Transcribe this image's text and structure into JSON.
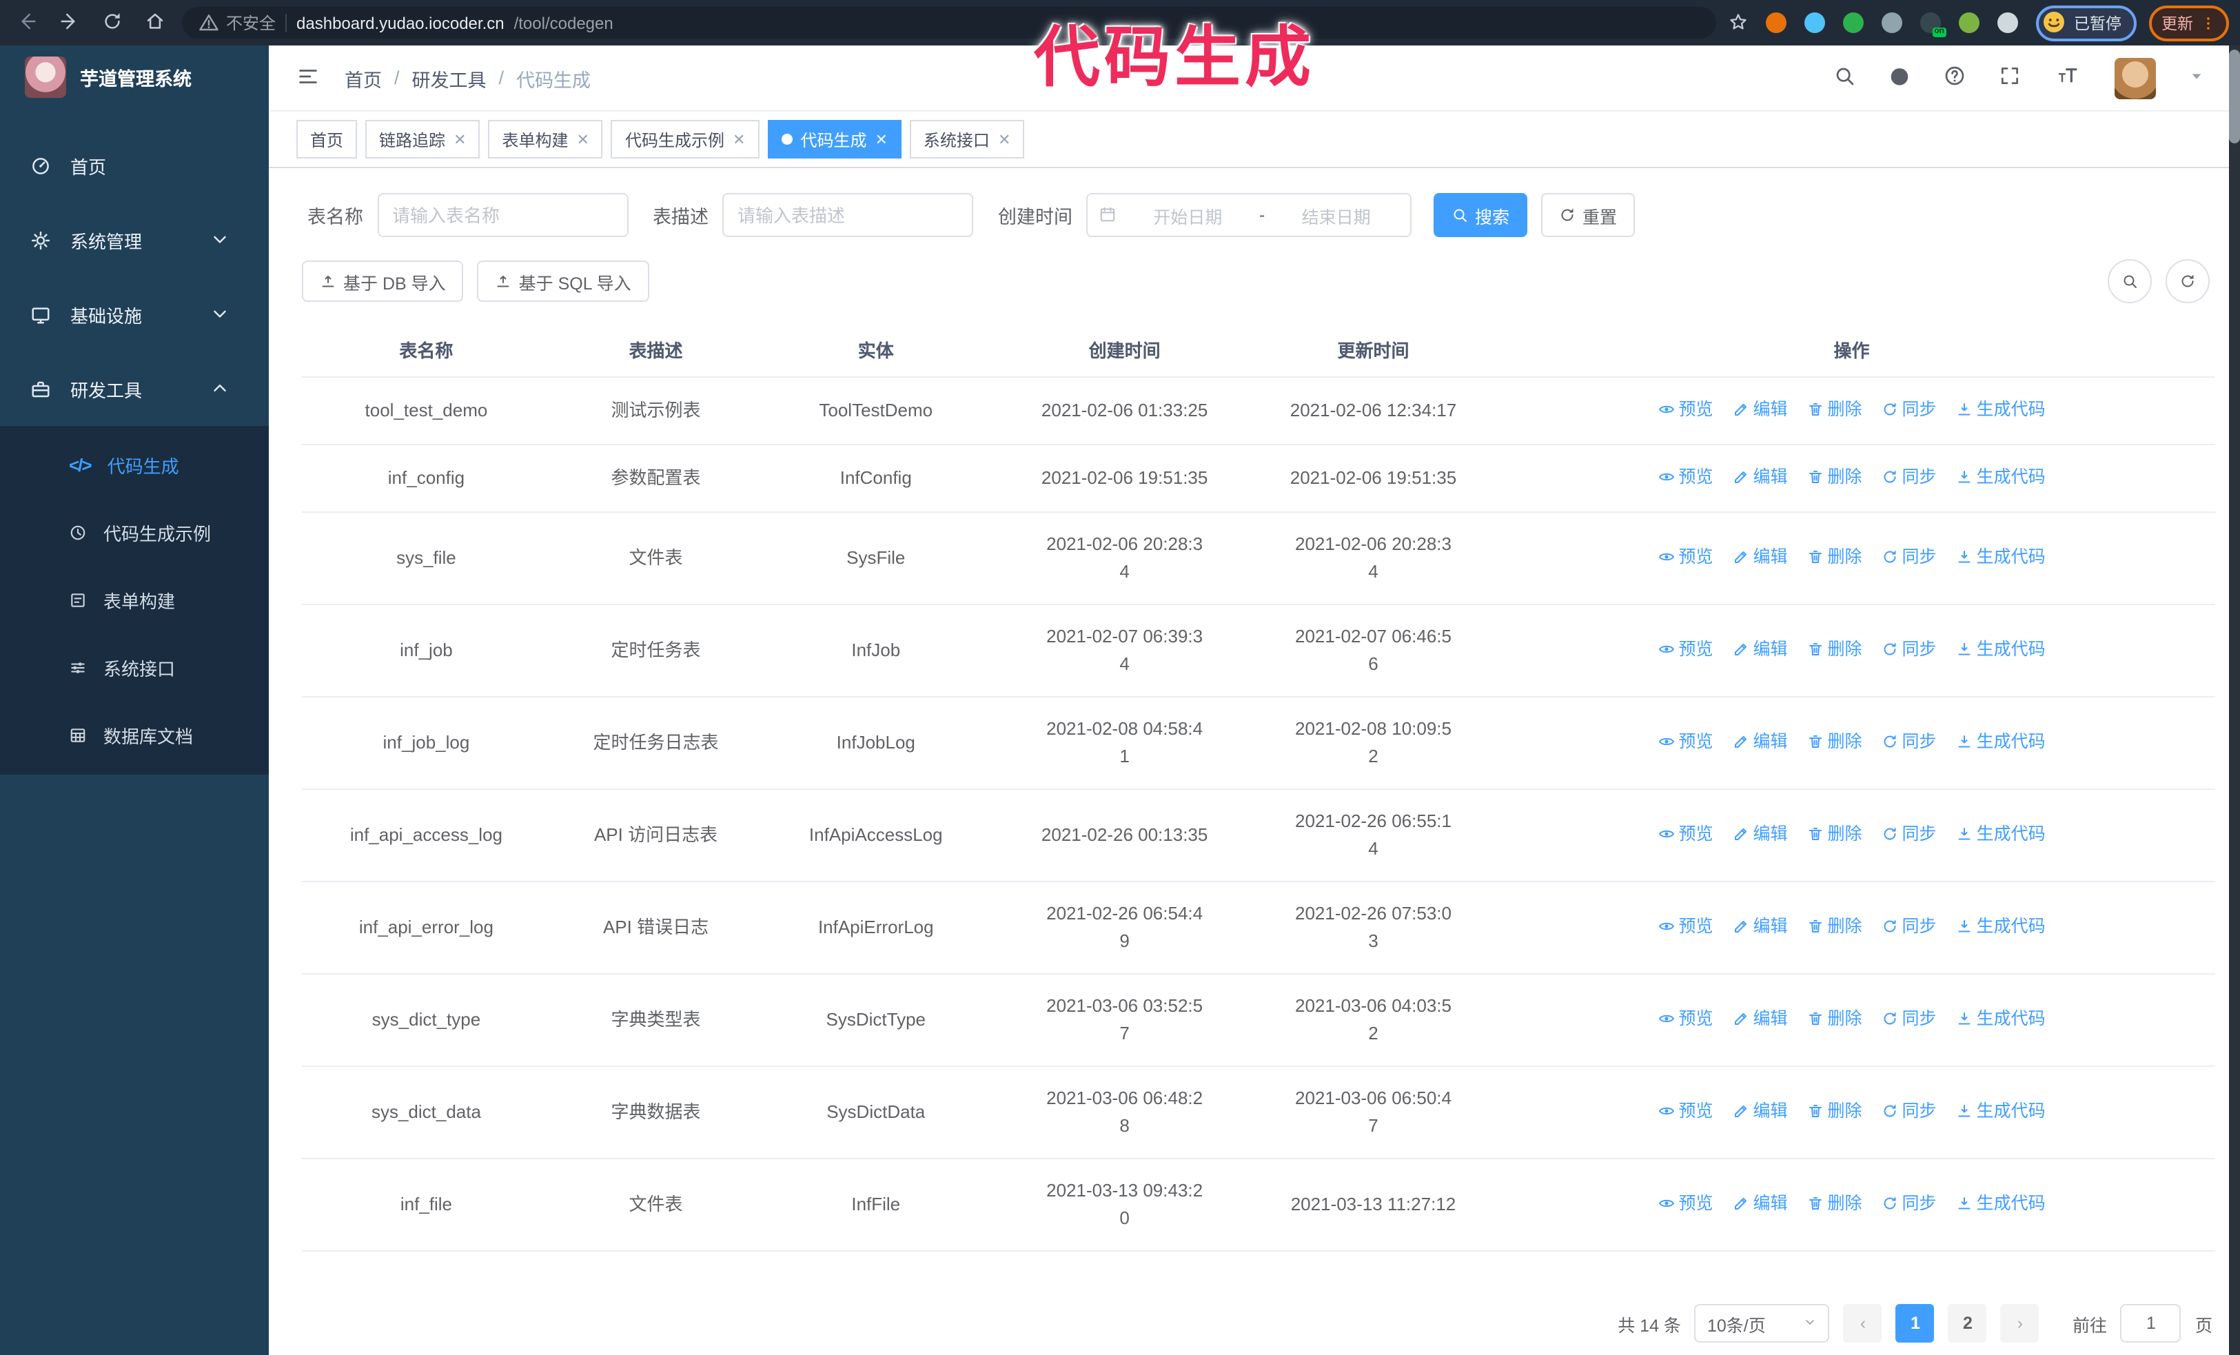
{
  "colors": {
    "accent": "#409eff",
    "annotation": "#ee2c5c",
    "sidebar_bg": "#204058",
    "submenu_bg": "#1a2c40"
  },
  "annotation": {
    "text": "代码生成"
  },
  "browser": {
    "security_label": "不安全",
    "url_host": "dashboard.yudao.iocoder.cn",
    "url_path": "/tool/codegen",
    "profile_chip_label": "已暂停",
    "update_label": "更新",
    "extensions": [
      {
        "name": "ext-orange",
        "color": "#e8710a"
      },
      {
        "name": "ext-blue-drop",
        "color": "#4fc3f7"
      },
      {
        "name": "ext-green-check",
        "color": "#2bb24c"
      },
      {
        "name": "ext-grid",
        "color": "#90a4ae"
      },
      {
        "name": "ext-dark-on",
        "color": "#37474f",
        "badge": "on"
      },
      {
        "name": "ext-green",
        "color": "#7cb342"
      },
      {
        "name": "ext-puzzle",
        "color": "#cfd8dc"
      }
    ]
  },
  "sidebar": {
    "title": "芋道管理系统",
    "items": [
      {
        "label": "首页",
        "icon": "dashboard",
        "chevron": ""
      },
      {
        "label": "系统管理",
        "icon": "gear",
        "chevron": "down"
      },
      {
        "label": "基础设施",
        "icon": "monitor",
        "chevron": "down"
      },
      {
        "label": "研发工具",
        "icon": "toolbox",
        "chevron": "up"
      }
    ],
    "submenu": [
      {
        "label": "代码生成",
        "icon": "code",
        "active": true
      },
      {
        "label": "代码生成示例",
        "icon": "example",
        "active": false
      },
      {
        "label": "表单构建",
        "icon": "form",
        "active": false
      },
      {
        "label": "系统接口",
        "icon": "sliders",
        "active": false
      },
      {
        "label": "数据库文档",
        "icon": "database",
        "active": false
      }
    ]
  },
  "header": {
    "breadcrumb": [
      "首页",
      "研发工具",
      "代码生成"
    ]
  },
  "tabs": [
    {
      "label": "首页",
      "closable": false,
      "active": false
    },
    {
      "label": "链路追踪",
      "closable": true,
      "active": false
    },
    {
      "label": "表单构建",
      "closable": true,
      "active": false
    },
    {
      "label": "代码生成示例",
      "closable": true,
      "active": false
    },
    {
      "label": "代码生成",
      "closable": true,
      "active": true
    },
    {
      "label": "系统接口",
      "closable": true,
      "active": false
    }
  ],
  "filters": {
    "name_label": "表名称",
    "name_placeholder": "请输入表名称",
    "desc_label": "表描述",
    "desc_placeholder": "请输入表描述",
    "time_label": "创建时间",
    "start_placeholder": "开始日期",
    "range_separator": "-",
    "end_placeholder": "结束日期",
    "search_label": "搜索",
    "reset_label": "重置"
  },
  "toolbar": {
    "import_db_label": "基于 DB 导入",
    "import_sql_label": "基于 SQL 导入"
  },
  "table": {
    "columns": [
      "表名称",
      "表描述",
      "实体",
      "创建时间",
      "更新时间",
      "操作"
    ],
    "actions": [
      {
        "label": "预览",
        "icon": "eye"
      },
      {
        "label": "编辑",
        "icon": "edit"
      },
      {
        "label": "删除",
        "icon": "delete"
      },
      {
        "label": "同步",
        "icon": "sync"
      },
      {
        "label": "生成代码",
        "icon": "download"
      }
    ],
    "rows": [
      {
        "name": "tool_test_demo",
        "desc": "测试示例表",
        "entity": "ToolTestDemo",
        "created": "2021-02-06 01:33:25",
        "updated": "2021-02-06 12:34:17"
      },
      {
        "name": "inf_config",
        "desc": "参数配置表",
        "entity": "InfConfig",
        "created": "2021-02-06 19:51:35",
        "updated": "2021-02-06 19:51:35"
      },
      {
        "name": "sys_file",
        "desc": "文件表",
        "entity": "SysFile",
        "created": "2021-02-06 20:28:3\n4",
        "updated": "2021-02-06 20:28:3\n4"
      },
      {
        "name": "inf_job",
        "desc": "定时任务表",
        "entity": "InfJob",
        "created": "2021-02-07 06:39:3\n4",
        "updated": "2021-02-07 06:46:5\n6"
      },
      {
        "name": "inf_job_log",
        "desc": "定时任务日志表",
        "entity": "InfJobLog",
        "created": "2021-02-08 04:58:4\n1",
        "updated": "2021-02-08 10:09:5\n2"
      },
      {
        "name": "inf_api_access_log",
        "desc": "API 访问日志表",
        "entity": "InfApiAccessLog",
        "created": "2021-02-26 00:13:35",
        "updated": "2021-02-26 06:55:1\n4"
      },
      {
        "name": "inf_api_error_log",
        "desc": "API 错误日志",
        "entity": "InfApiErrorLog",
        "created": "2021-02-26 06:54:4\n9",
        "updated": "2021-02-26 07:53:0\n3"
      },
      {
        "name": "sys_dict_type",
        "desc": "字典类型表",
        "entity": "SysDictType",
        "created": "2021-03-06 03:52:5\n7",
        "updated": "2021-03-06 04:03:5\n2"
      },
      {
        "name": "sys_dict_data",
        "desc": "字典数据表",
        "entity": "SysDictData",
        "created": "2021-03-06 06:48:2\n8",
        "updated": "2021-03-06 06:50:4\n7"
      },
      {
        "name": "inf_file",
        "desc": "文件表",
        "entity": "InfFile",
        "created": "2021-03-13 09:43:2\n0",
        "updated": "2021-03-13 11:27:12"
      }
    ]
  },
  "pagination": {
    "total_label": "共 14 条",
    "page_size": "10条/页",
    "pages": [
      "1",
      "2"
    ],
    "active_page": "1",
    "goto_label": "前往",
    "goto_value": "1",
    "unit_label": "页"
  }
}
